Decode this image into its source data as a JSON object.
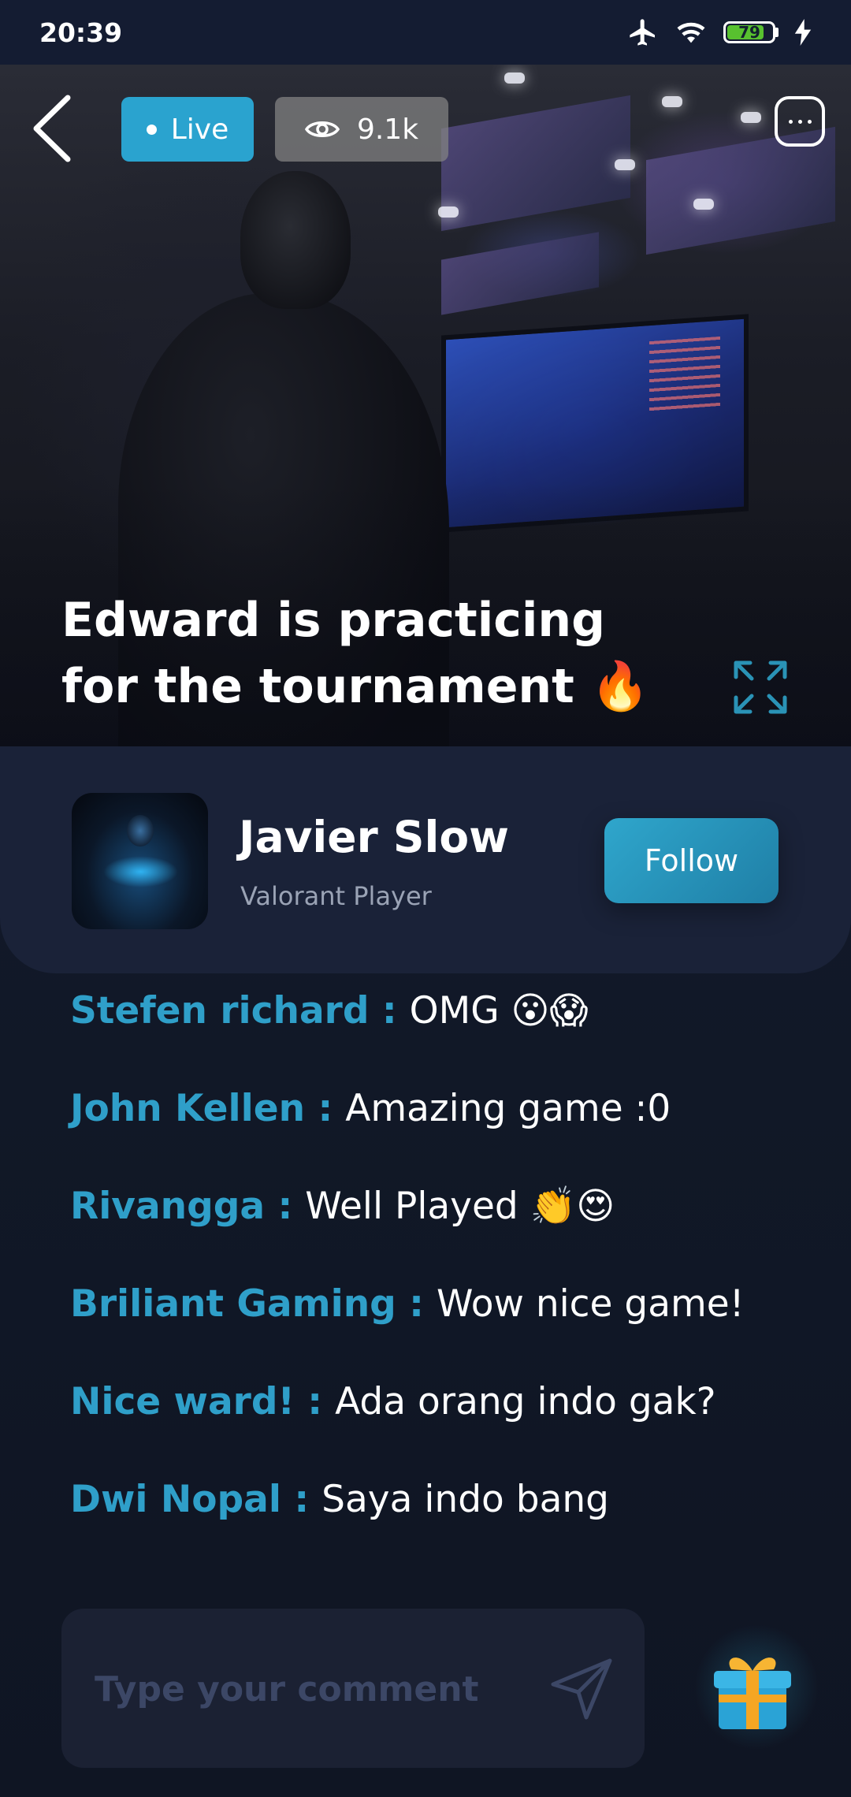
{
  "status_bar": {
    "time": "20:39",
    "battery": "79"
  },
  "video": {
    "live_label": "Live",
    "viewers": "9.1k",
    "title_line1": "Edward is practicing",
    "title_line2": "for the tournament 🔥"
  },
  "streamer": {
    "name": "Javier Slow",
    "role": "Valorant Player",
    "follow_label": "Follow"
  },
  "comments": [
    {
      "user": "Stefen richard :",
      "text": "OMG 😮😱"
    },
    {
      "user": "John Kellen :",
      "text": "Amazing game :0"
    },
    {
      "user": "Rivangga :",
      "text": "Well Played 👏😍"
    },
    {
      "user": "Briliant Gaming :",
      "text": "Wow nice game!"
    },
    {
      "user": "Nice ward! :",
      "text": "Ada orang indo gak?"
    },
    {
      "user": "Dwi Nopal :",
      "text": "Saya indo bang"
    }
  ],
  "comment_input": {
    "placeholder": "Type your comment",
    "value": ""
  },
  "icons": {
    "back": "back-arrow-icon",
    "viewers": "eye-icon",
    "more": "more-icon",
    "expand": "expand-icon",
    "send": "send-icon",
    "gift": "gift-icon"
  },
  "colors": {
    "accent": "#2aa3cf",
    "background": "#121a2b",
    "card": "#1a2238"
  }
}
